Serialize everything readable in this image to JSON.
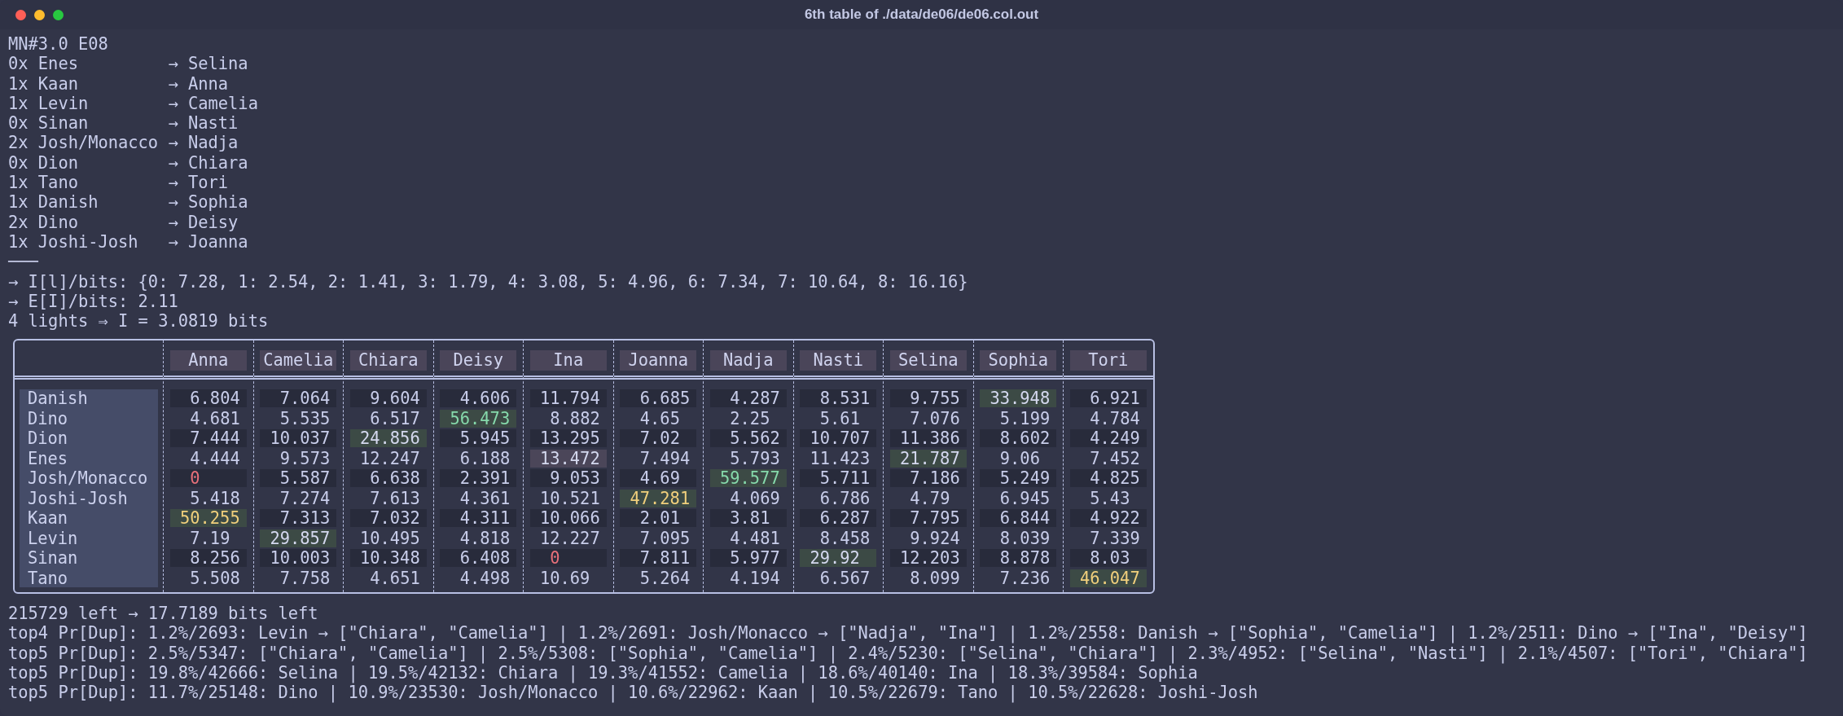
{
  "window": {
    "title": "6th table of ./data/de06/de06.col.out"
  },
  "lines_before": [
    "MN#3.0 E08",
    "0x Enes         → Selina",
    "1x Kaan         → Anna",
    "1x Levin        → Camelia",
    "0x Sinan        → Nasti",
    "2x Josh/Monacco → Nadja",
    "0x Dion         → Chiara",
    "1x Tano         → Tori",
    "1x Danish       → Sophia",
    "2x Dino         → Deisy",
    "1x Joshi-Josh   → Joanna",
    "───",
    "→ I[l]/bits: {0: 7.28, 1: 2.54, 2: 1.41, 3: 1.79, 4: 3.08, 5: 4.96, 6: 7.34, 7: 10.64, 8: 16.16}",
    "→ E[I]/bits: 2.11",
    "4 lights ⇒ I = 3.0819 bits"
  ],
  "table": {
    "columns": [
      "Anna",
      "Camelia",
      "Chiara",
      "Deisy",
      "Ina",
      "Joanna",
      "Nadja",
      "Nasti",
      "Selina",
      "Sophia",
      "Tori"
    ],
    "rows": [
      {
        "name": "Danish",
        "cells": [
          {
            "value": "6.804",
            "kind": "plain"
          },
          {
            "value": "7.064",
            "kind": "plain"
          },
          {
            "value": "9.604",
            "kind": "plain"
          },
          {
            "value": "4.606",
            "kind": "plain"
          },
          {
            "value": "11.794",
            "kind": "plain"
          },
          {
            "value": "6.685",
            "kind": "plain"
          },
          {
            "value": "4.287",
            "kind": "plain"
          },
          {
            "value": "8.531",
            "kind": "plain"
          },
          {
            "value": "9.755",
            "kind": "plain"
          },
          {
            "value": "33.948",
            "kind": "match"
          },
          {
            "value": "6.921",
            "kind": "plain"
          }
        ]
      },
      {
        "name": "Dino",
        "cells": [
          {
            "value": "4.681",
            "kind": "plain"
          },
          {
            "value": "5.535",
            "kind": "plain"
          },
          {
            "value": "6.517",
            "kind": "plain"
          },
          {
            "value": "56.473",
            "kind": "strong"
          },
          {
            "value": "8.882",
            "kind": "plain"
          },
          {
            "value": "4.65",
            "kind": "plain"
          },
          {
            "value": "2.25",
            "kind": "plain"
          },
          {
            "value": "5.61",
            "kind": "plain"
          },
          {
            "value": "7.076",
            "kind": "plain"
          },
          {
            "value": "5.199",
            "kind": "plain"
          },
          {
            "value": "4.784",
            "kind": "plain"
          }
        ]
      },
      {
        "name": "Dion",
        "cells": [
          {
            "value": "7.444",
            "kind": "plain"
          },
          {
            "value": "10.037",
            "kind": "plain"
          },
          {
            "value": "24.856",
            "kind": "match"
          },
          {
            "value": "5.945",
            "kind": "plain"
          },
          {
            "value": "13.295",
            "kind": "plain"
          },
          {
            "value": "7.02",
            "kind": "plain"
          },
          {
            "value": "5.562",
            "kind": "plain"
          },
          {
            "value": "10.707",
            "kind": "plain"
          },
          {
            "value": "11.386",
            "kind": "plain"
          },
          {
            "value": "8.602",
            "kind": "plain"
          },
          {
            "value": "4.249",
            "kind": "plain"
          }
        ]
      },
      {
        "name": "Enes",
        "cells": [
          {
            "value": "4.444",
            "kind": "plain"
          },
          {
            "value": "9.573",
            "kind": "plain"
          },
          {
            "value": "12.247",
            "kind": "plain"
          },
          {
            "value": "6.188",
            "kind": "plain"
          },
          {
            "value": "13.472",
            "kind": "mark"
          },
          {
            "value": "7.494",
            "kind": "plain"
          },
          {
            "value": "5.793",
            "kind": "plain"
          },
          {
            "value": "11.423",
            "kind": "plain"
          },
          {
            "value": "21.787",
            "kind": "match"
          },
          {
            "value": "9.06",
            "kind": "plain"
          },
          {
            "value": "7.452",
            "kind": "plain"
          }
        ]
      },
      {
        "name": "Josh/Monacco",
        "cells": [
          {
            "value": "0",
            "kind": "zero"
          },
          {
            "value": "5.587",
            "kind": "plain"
          },
          {
            "value": "6.638",
            "kind": "plain"
          },
          {
            "value": "2.391",
            "kind": "plain"
          },
          {
            "value": "9.053",
            "kind": "plain"
          },
          {
            "value": "4.69",
            "kind": "plain"
          },
          {
            "value": "59.577",
            "kind": "strong"
          },
          {
            "value": "5.711",
            "kind": "plain"
          },
          {
            "value": "7.186",
            "kind": "plain"
          },
          {
            "value": "5.249",
            "kind": "plain"
          },
          {
            "value": "4.825",
            "kind": "plain"
          }
        ]
      },
      {
        "name": "Joshi-Josh",
        "cells": [
          {
            "value": "5.418",
            "kind": "plain"
          },
          {
            "value": "7.274",
            "kind": "plain"
          },
          {
            "value": "7.613",
            "kind": "plain"
          },
          {
            "value": "4.361",
            "kind": "plain"
          },
          {
            "value": "10.521",
            "kind": "plain"
          },
          {
            "value": "47.281",
            "kind": "gold"
          },
          {
            "value": "4.069",
            "kind": "plain"
          },
          {
            "value": "6.786",
            "kind": "plain"
          },
          {
            "value": "4.79",
            "kind": "plain"
          },
          {
            "value": "6.945",
            "kind": "plain"
          },
          {
            "value": "5.43",
            "kind": "plain"
          }
        ]
      },
      {
        "name": "Kaan",
        "cells": [
          {
            "value": "50.255",
            "kind": "gold"
          },
          {
            "value": "7.313",
            "kind": "plain"
          },
          {
            "value": "7.032",
            "kind": "plain"
          },
          {
            "value": "4.311",
            "kind": "plain"
          },
          {
            "value": "10.066",
            "kind": "plain"
          },
          {
            "value": "2.01",
            "kind": "plain"
          },
          {
            "value": "3.81",
            "kind": "plain"
          },
          {
            "value": "6.287",
            "kind": "plain"
          },
          {
            "value": "7.795",
            "kind": "plain"
          },
          {
            "value": "6.844",
            "kind": "plain"
          },
          {
            "value": "4.922",
            "kind": "plain"
          }
        ]
      },
      {
        "name": "Levin",
        "cells": [
          {
            "value": "7.19",
            "kind": "plain"
          },
          {
            "value": "29.857",
            "kind": "match"
          },
          {
            "value": "10.495",
            "kind": "plain"
          },
          {
            "value": "4.818",
            "kind": "plain"
          },
          {
            "value": "12.227",
            "kind": "plain"
          },
          {
            "value": "7.095",
            "kind": "plain"
          },
          {
            "value": "4.481",
            "kind": "plain"
          },
          {
            "value": "8.458",
            "kind": "plain"
          },
          {
            "value": "9.924",
            "kind": "plain"
          },
          {
            "value": "8.039",
            "kind": "plain"
          },
          {
            "value": "7.339",
            "kind": "plain"
          }
        ]
      },
      {
        "name": "Sinan",
        "cells": [
          {
            "value": "8.256",
            "kind": "plain"
          },
          {
            "value": "10.003",
            "kind": "plain"
          },
          {
            "value": "10.348",
            "kind": "plain"
          },
          {
            "value": "6.408",
            "kind": "plain"
          },
          {
            "value": "0",
            "kind": "zero"
          },
          {
            "value": "7.811",
            "kind": "plain"
          },
          {
            "value": "5.977",
            "kind": "plain"
          },
          {
            "value": "29.92",
            "kind": "match"
          },
          {
            "value": "12.203",
            "kind": "plain"
          },
          {
            "value": "8.878",
            "kind": "plain"
          },
          {
            "value": "8.03",
            "kind": "plain"
          }
        ]
      },
      {
        "name": "Tano",
        "cells": [
          {
            "value": "5.508",
            "kind": "plain"
          },
          {
            "value": "7.758",
            "kind": "plain"
          },
          {
            "value": "4.651",
            "kind": "plain"
          },
          {
            "value": "4.498",
            "kind": "plain"
          },
          {
            "value": "10.69",
            "kind": "plain"
          },
          {
            "value": "5.264",
            "kind": "plain"
          },
          {
            "value": "4.194",
            "kind": "plain"
          },
          {
            "value": "6.567",
            "kind": "plain"
          },
          {
            "value": "8.099",
            "kind": "plain"
          },
          {
            "value": "7.236",
            "kind": "plain"
          },
          {
            "value": "46.047",
            "kind": "gold"
          }
        ]
      }
    ]
  },
  "lines_after": [
    "215729 left → 17.7189 bits left",
    "top4 Pr[Dup]: 1.2%/2693: Levin → [\"Chiara\", \"Camelia\"] | 1.2%/2691: Josh/Monacco → [\"Nadja\", \"Ina\"] | 1.2%/2558: Danish → [\"Sophia\", \"Camelia\"] | 1.2%/2511: Dino → [\"Ina\", \"Deisy\"]",
    "top5 Pr[Dup]: 2.5%/5347: [\"Chiara\", \"Camelia\"] | 2.5%/5308: [\"Sophia\", \"Camelia\"] | 2.4%/5230: [\"Selina\", \"Chiara\"] | 2.3%/4952: [\"Selina\", \"Nasti\"] | 2.1%/4507: [\"Tori\", \"Chiara\"]",
    "top5 Pr[Dup]: 19.8%/42666: Selina | 19.5%/42132: Chiara | 19.3%/41552: Camelia | 18.6%/40140: Ina | 18.3%/39584: Sophia",
    "top5 Pr[Dup]: 11.7%/25148: Dino | 10.9%/23530: Josh/Monacco | 10.6%/22962: Kaan | 10.5%/22679: Tano | 10.5%/22628: Joshi-Josh"
  ]
}
